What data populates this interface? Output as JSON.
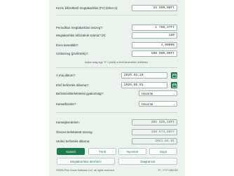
{
  "form": {
    "initial_amount": {
      "label": "Kezre kifizethető megtakarítási (FV) (lehet 0):",
      "value": "33 500,00Ft"
    },
    "periodic_amount": {
      "label": "Periodikus megtakarítási összeg?:",
      "value": "1 700,37Ft"
    },
    "periods": {
      "label": "Megtakarítási időszakok száma? (#):",
      "value": "180"
    },
    "interest_rate": {
      "label": "Éves kamatláb?:",
      "value": "4,0000%"
    },
    "target_amount": {
      "label": "Célösszeg (jövőérték)?:",
      "value": "500 000,00Ft"
    },
    "hint": "Adjon meg egy \"0\"-t (nullt) a fenti ismeretlen értékhez.",
    "start_date": {
      "label": "A mai dátum?:",
      "value": "2026.03.20"
    },
    "first_deposit_date": {
      "label": "Első befizetés dátuma?:",
      "value": "2026.05.01"
    },
    "deposit_frequency": {
      "label": "Befizetési/Befektetési gyakoriság?:",
      "value": "Havonta"
    },
    "compounding": {
      "label": "Kamatfizetés?:",
      "value": "Havonta"
    }
  },
  "results": {
    "interest_earned": {
      "label": "Kamatjövedelem:",
      "value": "261 325,24Ft"
    },
    "total_deposits": {
      "label": "Összes befektetett összeg:",
      "value": "338 674,66Ft"
    },
    "last_deposit_date": {
      "label": "Utolsó befizetés dátuma:",
      "value": "2041.04.01"
    }
  },
  "buttons": {
    "calc": "Számít",
    "clear": "Töröl",
    "print": "Nyomtat",
    "help": "Súgó",
    "schedule": "Megtakarítási ütemterv",
    "chart": "Diagramok"
  },
  "footer": {
    "copyright": "©2026 Pine Grove Software LLC, all rights reserved.",
    "format": "Ft : YYYY.MM.DD"
  },
  "colors": {
    "accent": "#1e7a4e",
    "panel": "#eaf3ee"
  },
  "icons": {
    "calendar": "calendar-icon",
    "dropdown": "chevron-down-icon"
  }
}
